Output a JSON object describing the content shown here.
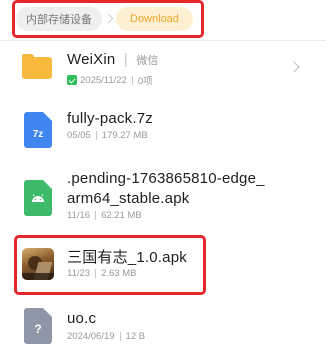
{
  "breadcrumb": {
    "root_label": "内部存储设备",
    "current_label": "Download"
  },
  "files": [
    {
      "name": "WeiXin",
      "tag": "微信",
      "date": "2025/11/22",
      "detail": "0项",
      "type": "folder",
      "icon": "folder-icon",
      "color": "#F8B93F"
    },
    {
      "name": "fully-pack.7z",
      "date": "05/05",
      "detail": "179.27 MB",
      "type": "archive",
      "icon": "archive-7z-icon",
      "icon_text": "7z",
      "color": "#3F86F0"
    },
    {
      "name_line1": ".pending-1763865810-edge_",
      "name_line2": "arm64_stable.apk",
      "date": "11/16",
      "detail": "62.21 MB",
      "type": "apk",
      "icon": "android-apk-icon",
      "color": "#3DBB6B"
    },
    {
      "name": "三国有志_1.0.apk",
      "date": "11/23",
      "detail": "2.63 MB",
      "type": "apk",
      "icon": "game-app-icon"
    },
    {
      "name": "uo.c",
      "date": "2024/06/19",
      "detail": "12 B",
      "type": "unknown",
      "icon": "unknown-file-icon",
      "icon_text": "?",
      "color": "#8E96A8"
    }
  ],
  "highlight_color": "#E5262B"
}
